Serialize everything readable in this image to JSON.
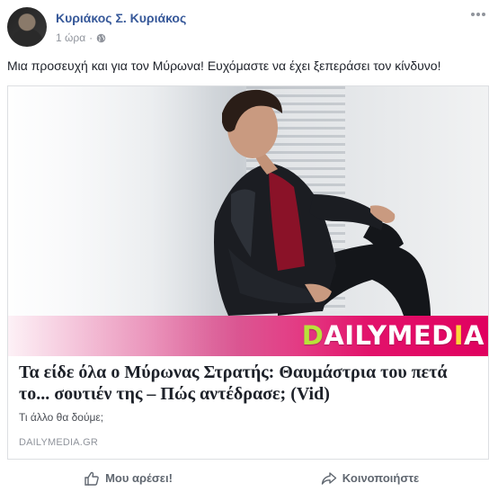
{
  "post": {
    "author": "Κυριάκος Σ. Κυριάκος",
    "time": "1 ώρα",
    "separator": "·",
    "privacy_icon": "globe-icon",
    "more_icon": "more-options-icon",
    "status_text": "Μια προσευχή και για τον Μύρωνα! Ευχόμαστε να έχει ξεπεράσει τον κίνδυνο!"
  },
  "link_card": {
    "brand_prefix": "D",
    "brand_middle": "AILYMED",
    "brand_a": "I",
    "brand_suffix": "A",
    "title": "Τα είδε όλα ο Μύρωνας Στρατής: Θαυμάστρια του πετά το... σουτιέν της – Πώς αντέδρασε; (Vid)",
    "description": "Τι άλλο θα δούμε;",
    "domain": "DAILYMEDIA.GR"
  },
  "actions": {
    "like_label": "Μου αρέσει!",
    "like_icon": "thumbs-up-icon",
    "share_label": "Κοινοποιήστε",
    "share_icon": "share-arrow-icon"
  },
  "colors": {
    "author": "#365899",
    "brand_band": "#e0005f",
    "meta": "#90949c"
  }
}
